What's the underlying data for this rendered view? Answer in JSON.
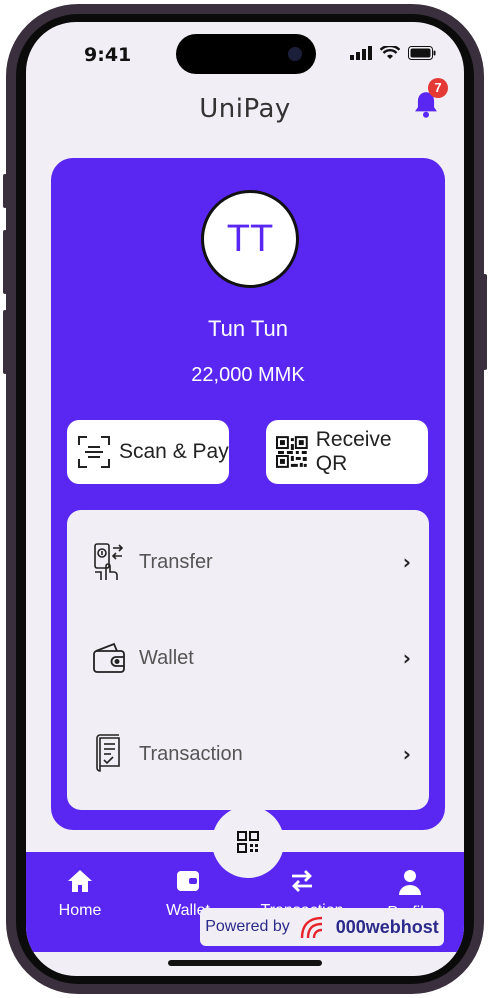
{
  "status_bar": {
    "time": "9:41"
  },
  "app": {
    "title": "UniPay",
    "notification_count": "7"
  },
  "profile": {
    "initials": "TT",
    "name": "Tun Tun",
    "balance": "22,000 MMK"
  },
  "actions": [
    {
      "label": "Scan & Pay",
      "icon": "scan-icon"
    },
    {
      "label": "Receive QR",
      "icon": "qr-code-icon"
    }
  ],
  "menu": [
    {
      "label": "Transfer",
      "icon": "transfer-money-icon"
    },
    {
      "label": "Wallet",
      "icon": "wallet-icon"
    },
    {
      "label": "Transaction",
      "icon": "receipt-icon"
    }
  ],
  "bottom_nav": [
    {
      "label": "Home",
      "icon": "home-icon"
    },
    {
      "label": "Wallet",
      "icon": "wallet-icon"
    },
    {
      "label": "Transaction",
      "icon": "swap-arrows-icon"
    },
    {
      "label": "Profile",
      "icon": "user-icon"
    }
  ],
  "footer": {
    "powered_by": "Powered by",
    "host": "000webhost"
  },
  "colors": {
    "primary": "#5a27f2",
    "background": "#f1eff5",
    "badge": "#e53935"
  }
}
